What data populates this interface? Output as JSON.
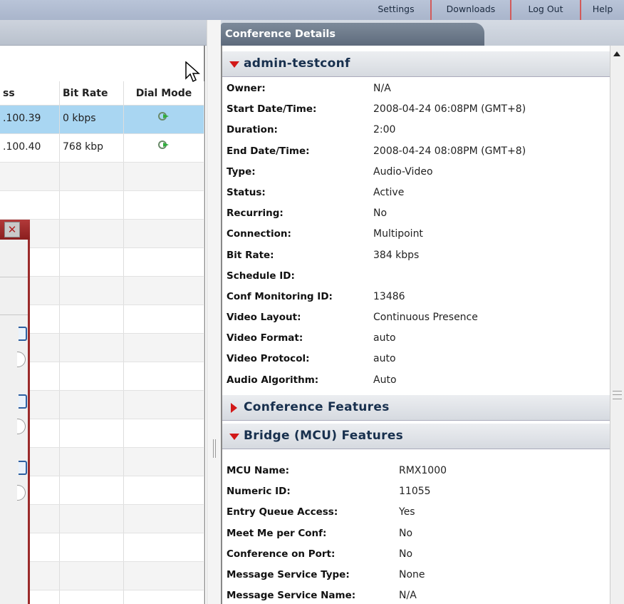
{
  "topnav": {
    "links": [
      "Settings",
      "Downloads",
      "Log Out",
      "Help"
    ]
  },
  "left_grid": {
    "headers": [
      "ss",
      "Bit Rate",
      "Dial Mode"
    ],
    "rows": [
      {
        "address": ".100.39",
        "bitrate": "0 kbps",
        "dial_icon": "dial-out-icon",
        "selected": true
      },
      {
        "address": ".100.40",
        "bitrate": "768 kbp",
        "dial_icon": "dial-out-icon",
        "selected": false
      }
    ]
  },
  "right": {
    "tab_label": "Conference Details",
    "conference_section": "admin-testconf",
    "fields": [
      {
        "label": "Owner:",
        "value": "N/A"
      },
      {
        "label": "Start Date/Time:",
        "value": "2008-04-24 06:08PM (GMT+8)"
      },
      {
        "label": "Duration:",
        "value": "2:00"
      },
      {
        "label": "End Date/Time:",
        "value": "2008-04-24 08:08PM (GMT+8)"
      },
      {
        "label": "Type:",
        "value": "Audio-Video"
      },
      {
        "label": "Status:",
        "value": "Active"
      },
      {
        "label": "Recurring:",
        "value": "No"
      },
      {
        "label": "Connection:",
        "value": "Multipoint"
      },
      {
        "label": "Bit Rate:",
        "value": "384 kbps"
      },
      {
        "label": "Schedule ID:",
        "value": ""
      },
      {
        "label": "Conf Monitoring ID:",
        "value": "13486"
      },
      {
        "label": "Video Layout:",
        "value": "Continuous Presence"
      },
      {
        "label": "Video Format:",
        "value": "auto"
      },
      {
        "label": "Video Protocol:",
        "value": "auto"
      },
      {
        "label": "Audio Algorithm:",
        "value": "Auto"
      }
    ],
    "features_section": "Conference Features",
    "bridge_section": "Bridge (MCU) Features",
    "bridge_fields": [
      {
        "label": "MCU Name:",
        "value": "RMX1000"
      },
      {
        "label": "Numeric ID:",
        "value": "11055"
      },
      {
        "label": "Entry Queue Access:",
        "value": "Yes"
      },
      {
        "label": "Meet Me per Conf:",
        "value": "No"
      },
      {
        "label": "Conference on Port:",
        "value": "No"
      },
      {
        "label": "Message Service Type:",
        "value": "None"
      },
      {
        "label": "Message Service Name:",
        "value": "N/A"
      }
    ]
  },
  "colors": {
    "accent_red": "#d21818",
    "selected_row": "#a9d6f2",
    "tab_bg": "#6e7b8c",
    "section_title": "#18304e"
  }
}
